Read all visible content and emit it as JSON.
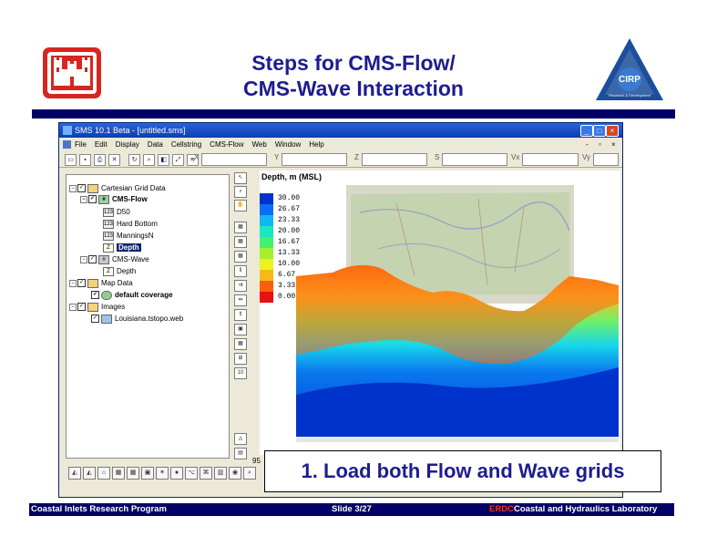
{
  "slide": {
    "title_line1": "Steps for CMS-Flow/",
    "title_line2": "CMS-Wave Interaction",
    "callout": "1. Load both Flow and Wave grids",
    "footer_left": "Coastal Inlets Research Program",
    "footer_center": "Slide 3/27",
    "footer_right_prefix": "ERDC",
    "footer_right": "Coastal and Hydraulics Laboratory",
    "logo_right_text": "CIRP",
    "logo_right_ring": "Research & Development",
    "colors": {
      "title": "#1d1d8f",
      "bar": "#000066",
      "castle": "#d7261e",
      "footer_accent": "#ff3300"
    }
  },
  "window": {
    "title": "SMS 10.1 Beta - [untitled.sms]",
    "controls": [
      "_",
      "□",
      "×"
    ],
    "menus": [
      "File",
      "Edit",
      "Display",
      "Data",
      "Cellstring",
      "CMS-Flow",
      "Web",
      "Window",
      "Help"
    ],
    "doc_controls": [
      "-",
      "▫",
      "×"
    ],
    "coord_labels": [
      "X",
      "Y",
      "Z",
      "S",
      "Vx",
      "Vy"
    ]
  },
  "tree": {
    "items": [
      {
        "label": "Cartesian Grid Data",
        "icon": "folder-icon"
      },
      {
        "label": "CMS-Flow",
        "icon": "grid-icon"
      },
      {
        "label": "D50",
        "icon": "dataset-icon"
      },
      {
        "label": "Hard Bottom",
        "icon": "dataset-icon"
      },
      {
        "label": "ManningsN",
        "icon": "dataset-icon"
      },
      {
        "label": "Depth",
        "icon": "z-dataset-icon",
        "selected": true
      },
      {
        "label": "CMS-Wave",
        "icon": "grid-icon"
      },
      {
        "label": "Depth",
        "icon": "z-dataset-icon"
      },
      {
        "label": "Map Data",
        "icon": "folder-icon"
      },
      {
        "label": "default coverage",
        "icon": "coverage-icon"
      },
      {
        "label": "Images",
        "icon": "folder-icon"
      },
      {
        "label": "Louisiana.tstopo.web",
        "icon": "image-icon"
      }
    ]
  },
  "legend": {
    "title": "Depth, m (MSL)",
    "entries": [
      {
        "value": "30.00",
        "color": "#0033cc"
      },
      {
        "value": "26.67",
        "color": "#0a6ef5"
      },
      {
        "value": "23.33",
        "color": "#12b8f0"
      },
      {
        "value": "20.00",
        "color": "#18e8c0"
      },
      {
        "value": "16.67",
        "color": "#44f070"
      },
      {
        "value": "13.33",
        "color": "#a4f030"
      },
      {
        "value": "10.00",
        "color": "#f0f020"
      },
      {
        "value": "6.67",
        "color": "#f8b818"
      },
      {
        "value": "3.33",
        "color": "#f86010"
      },
      {
        "value": "0.00",
        "color": "#e81010"
      }
    ]
  },
  "statusbar": {
    "partial": "95"
  }
}
